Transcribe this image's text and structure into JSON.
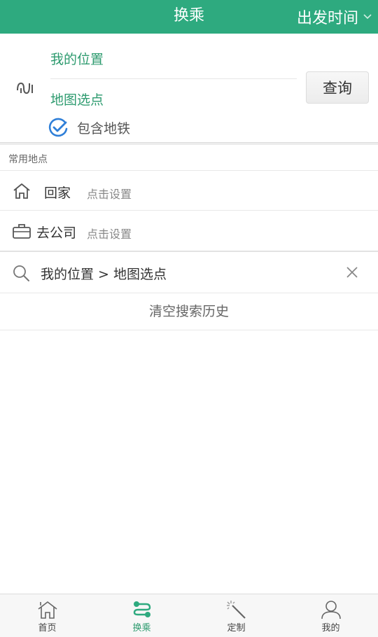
{
  "header": {
    "title": "换乘",
    "time_label": "出发时间",
    "icons": {
      "time_dropdown": "chevron-down-icon"
    }
  },
  "route": {
    "origin": "我的位置",
    "destination": "地图选点",
    "query_label": "查询",
    "include_subway_label": "包含地铁",
    "include_subway_checked": true,
    "icons": {
      "swap": "swap-route-icon",
      "subway_check": "check-circle-icon"
    }
  },
  "common_places": {
    "title": "常用地点",
    "items": [
      {
        "name": "回家",
        "hint": "点击设置",
        "icon": "home-icon"
      },
      {
        "name": "去公司",
        "hint": "点击设置",
        "icon": "briefcase-icon"
      }
    ]
  },
  "history": {
    "items": [
      {
        "text": "我的位置 > 地图选点",
        "icon": "search-icon"
      }
    ],
    "clear_label": "清空搜索历史"
  },
  "tabbar": {
    "active": "换乘",
    "items": [
      {
        "label": "首页",
        "icon": "home-tab-icon"
      },
      {
        "label": "换乘",
        "icon": "transfer-tab-icon"
      },
      {
        "label": "定制",
        "icon": "magic-wand-icon"
      },
      {
        "label": "我的",
        "icon": "user-icon"
      }
    ]
  },
  "colors": {
    "brand": "#2eaa7f",
    "accent_text": "#2e9b6f",
    "check_blue": "#2f7fd8"
  }
}
